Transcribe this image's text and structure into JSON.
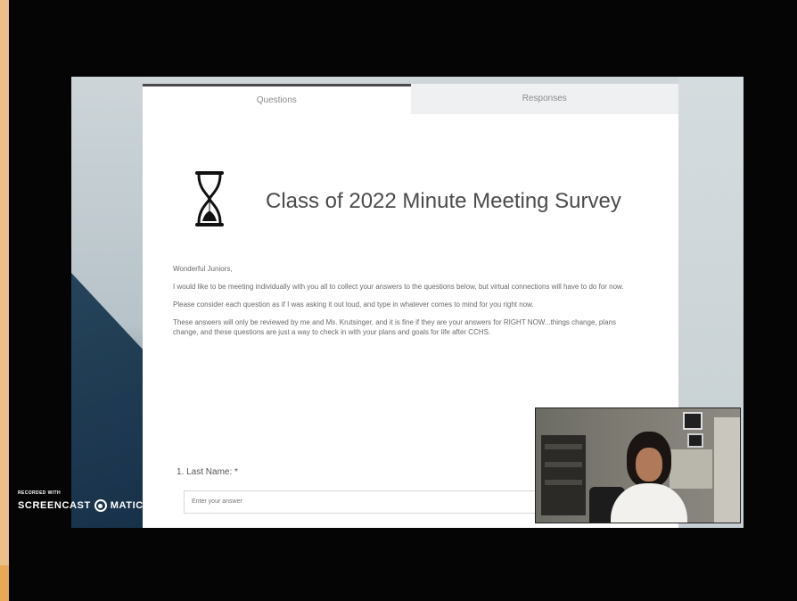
{
  "tabs": [
    {
      "label": "Questions",
      "active": true
    },
    {
      "label": "Responses",
      "active": false
    }
  ],
  "form": {
    "title": "Class of 2022 Minute Meeting Survey",
    "paragraphs": [
      "Wonderful Juniors,",
      "I would like to be meeting individually with you all to collect your answers to the questions below, but virtual connections will have to do for now.",
      "Please consider each question as if I was asking it out loud, and type in whatever comes to mind for you right now.",
      "These answers will only be reviewed by me and Ms. Krutsinger, and it is fine if they are your answers for RIGHT NOW...things change, plans change, and these questions are just a way to check in with your plans and goals for life after CCHS."
    ],
    "question_1": {
      "label": "1. Last Name: *",
      "placeholder": "Enter your answer"
    }
  },
  "watermark": {
    "recorded_with": "RECORDED WITH",
    "brand_left": "SCREENCAST",
    "brand_right": "MATIC"
  },
  "colors": {
    "page_bg": "#050505",
    "card_bg": "#ffffff",
    "active_tab_border": "#4a4a4a",
    "title_text": "#4b4b4b"
  }
}
